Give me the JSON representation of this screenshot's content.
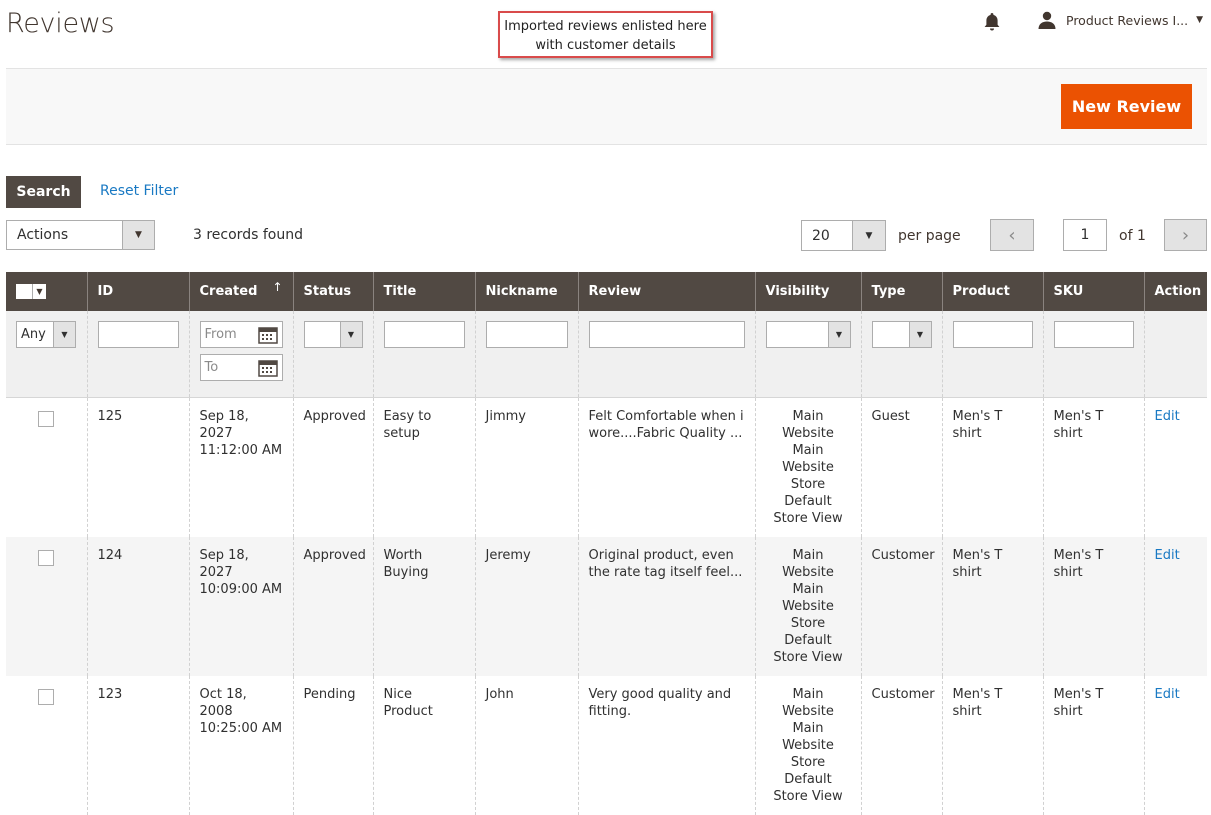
{
  "header": {
    "title": "Reviews",
    "callout": [
      "Imported reviews enlisted here",
      "with customer details"
    ],
    "user_name": "Product Reviews I..."
  },
  "toolbar": {
    "new_review_label": "New Review"
  },
  "filters_bar": {
    "search_label": "Search",
    "reset_label": "Reset Filter",
    "actions_label": "Actions",
    "records_found": "3 records found",
    "per_page_value": "20",
    "per_page_label": "per page",
    "page_value": "1",
    "page_of": "of 1"
  },
  "table": {
    "columns": [
      "ID",
      "Created",
      "Status",
      "Title",
      "Nickname",
      "Review",
      "Visibility",
      "Type",
      "Product",
      "SKU",
      "Action"
    ],
    "filters": {
      "any": "Any",
      "from_placeholder": "From",
      "to_placeholder": "To"
    },
    "rows": [
      {
        "id": "125",
        "created": [
          "Sep 18, 2027",
          "11:12:00 AM"
        ],
        "status": "Approved",
        "title": "Easy to setup",
        "nickname": "Jimmy",
        "review": "Felt Comfortable when i wore....Fabric Quality ...",
        "visibility": [
          "Main Website",
          "Main",
          "Website Store",
          "Default",
          "Store View"
        ],
        "type": "Guest",
        "product": "Men's T shirt",
        "sku": "Men's T shirt",
        "action": "Edit"
      },
      {
        "id": "124",
        "created": [
          "Sep 18, 2027",
          "10:09:00 AM"
        ],
        "status": "Approved",
        "title": "Worth Buying",
        "nickname": "Jeremy",
        "review": "Original product, even the rate tag itself feel...",
        "visibility": [
          "Main Website",
          "Main",
          "Website Store",
          "Default",
          "Store View"
        ],
        "type": "Customer",
        "product": "Men's T shirt",
        "sku": "Men's T shirt",
        "action": "Edit"
      },
      {
        "id": "123",
        "created": [
          "Oct 18, 2008",
          "10:25:00 AM"
        ],
        "status": "Pending",
        "title": "Nice Product",
        "nickname": "John",
        "review": "Very good quality and fitting.",
        "visibility": [
          "Main Website",
          "Main",
          "Website Store",
          "Default",
          "Store View"
        ],
        "type": "Customer",
        "product": "Men's T shirt",
        "sku": "Men's T shirt",
        "action": "Edit"
      }
    ]
  },
  "colors": {
    "accent": "#eb5202",
    "header_bg": "#514943",
    "link": "#1979c3",
    "callout_border": "#d94b4b"
  }
}
